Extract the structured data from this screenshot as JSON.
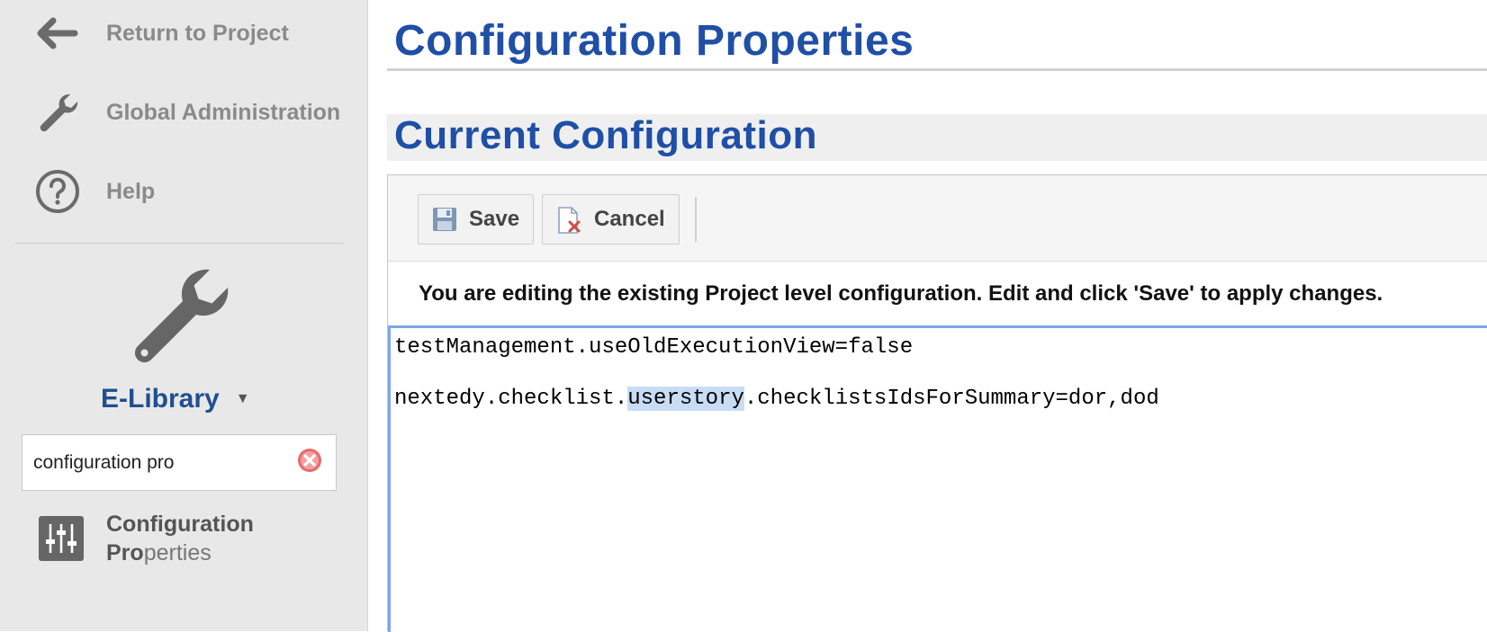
{
  "sidebar": {
    "nav": [
      {
        "label": "Return to Project",
        "icon": "arrow-left-icon"
      },
      {
        "label": "Global Administration",
        "icon": "wrench-icon"
      },
      {
        "label": "Help",
        "icon": "help-circle-icon"
      }
    ],
    "project": {
      "name": "E-Library",
      "icon": "wrench-icon",
      "dropdown_icon": "caret-down-icon"
    },
    "search": {
      "value": "configuration pro",
      "clear_icon": "clear-x-icon"
    },
    "result": {
      "label_line1": "Configuration",
      "label_line2_match": "Pro",
      "label_line2_rest": "perties",
      "icon": "sliders-icon"
    }
  },
  "main": {
    "title": "Configuration Properties",
    "section_title": "Current Configuration",
    "toolbar": {
      "save_label": "Save",
      "cancel_label": "Cancel"
    },
    "info": "You are editing the existing Project level configuration. Edit and click 'Save' to apply changes.",
    "editor": {
      "line1": "testManagement.useOldExecutionView=false",
      "line2_before": "nextedy.checklist.",
      "line2_selected": "userstory",
      "line2_after": ".checklistsIdsForSummary=dor,dod"
    }
  },
  "colors": {
    "heading_blue": "#1f4fa6",
    "project_blue": "#1f4f8f",
    "sidebar_bg": "#e8e8e8",
    "selection": "#c9dcf5",
    "editor_focus": "#7ea6e6",
    "clear_red": "#e86a6a"
  }
}
